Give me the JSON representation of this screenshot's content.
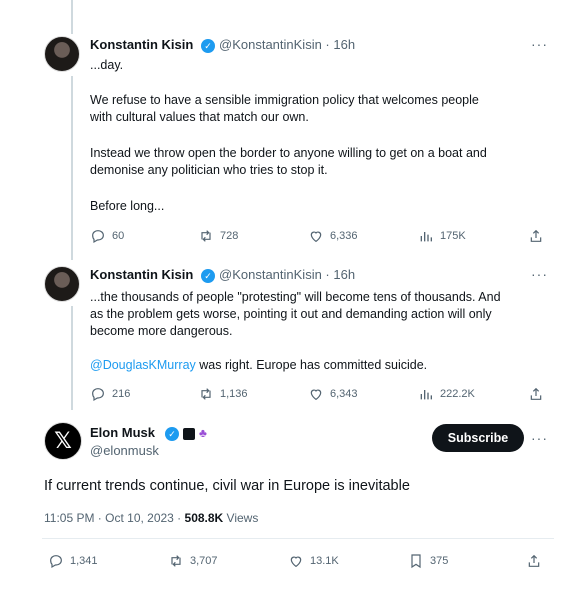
{
  "tweet1": {
    "name": "Konstantin Kisin",
    "handle": "@KonstantinKisin · 16h",
    "lines": [
      "...day.",
      "We refuse to have a sensible immigration policy that welcomes people",
      "with cultural values that match our own.",
      "Instead we throw open the border to anyone willing to get on a boat and",
      "demonise any politician who tries to stop it.",
      "Before long..."
    ],
    "replies": "60",
    "reposts": "728",
    "likes": "6,336",
    "views": "175K"
  },
  "tweet2": {
    "name": "Konstantin Kisin",
    "handle": "@KonstantinKisin · 16h",
    "lines": [
      "...the thousands of people \"protesting\" will become tens of thousands. And",
      "as the problem gets worse, pointing it out and demanding action will only",
      "become more dangerous."
    ],
    "mention": "@DouglasKMurray",
    "mention_rest": " was right. Europe has committed suicide.",
    "replies": "216",
    "reposts": "1,136",
    "likes": "6,343",
    "views": "222.2K"
  },
  "main": {
    "name": "Elon Musk",
    "handle": "@elonmusk",
    "subscribe_label": "Subscribe",
    "text": "If current trends continue, civil war in Europe is inevitable",
    "timestamp": "11:05 PM · Oct 10, 2023 · ",
    "views_count": "508.8K",
    "views_label": " Views",
    "replies": "1,341",
    "reposts": "3,707",
    "likes": "13.1K",
    "bookmarks": "375"
  },
  "more_glyph": "···",
  "verified_glyph": "✓",
  "colors": {
    "accent": "#1d9bf0",
    "muted": "#536471",
    "text": "#0f1419"
  }
}
